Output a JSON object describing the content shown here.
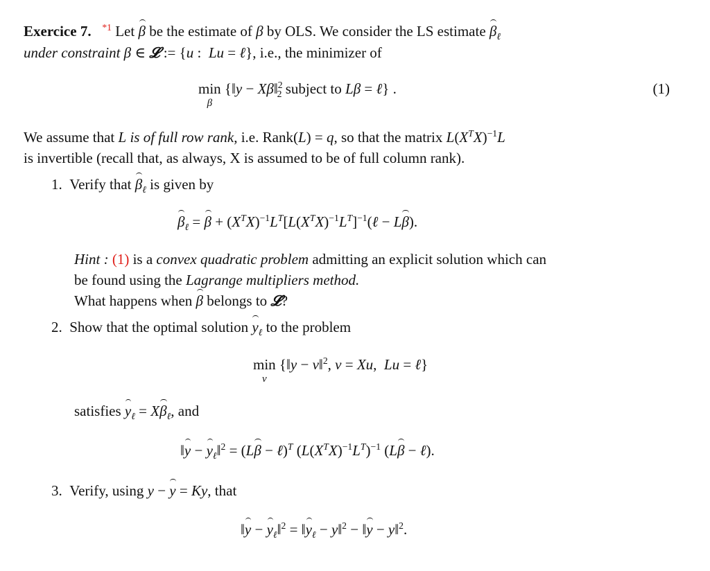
{
  "exercise": {
    "title": "Exercice 7.",
    "footnote_mark": "* 1",
    "intro_line1": "Let β̂ be the estimate of β by OLS. We consider the LS estimate β̂ℓ",
    "intro_line2": "under constraint β ∈ 𝓛 := {u : Lu = ℓ}, i.e., the minimizer of",
    "eq1": "min_β {‖y − Xβ‖₂² subject to Lβ = ℓ} .",
    "eq1_label": "(1)",
    "assume_line1": "We assume that L is of full row rank, i.e. Rank(L) = q, so that the matrix L(XᵀX)⁻¹L",
    "assume_line2": "is invertible (recall that, as always, X is assumed to be of full column rank).",
    "items": [
      {
        "num": "1.",
        "text": "Verify that β̂ℓ is given by",
        "equation": "β̂ℓ = β̂ + (XᵀX)⁻¹Lᵀ[L(XᵀX)⁻¹Lᵀ]⁻¹(ℓ − Lβ̂).",
        "hint_label": "Hint :",
        "hint_ref": "(1)",
        "hint_line1": "is a convex quadratic problem admitting an explicit solution which can",
        "hint_line2": "be found using the Lagrange multipliers method.",
        "hint_line3": "What happens when β̂ belongs to 𝓛?"
      },
      {
        "num": "2.",
        "text": "Show that the optimal solution ŷℓ to the problem",
        "equation": "min_v {‖y − v‖², v = Xu, Lu = ℓ}",
        "satisfies": "satisfies ŷℓ = Xβ̂ℓ, and",
        "equation2": "‖ŷ − ŷℓ‖² = (Lβ̂ − ℓ)ᵀ (L(XᵀX)⁻¹Lᵀ)⁻¹ (Lβ̂ − ℓ)."
      },
      {
        "num": "3.",
        "text": "Verify, using y − ŷ = Ky, that",
        "equation": "‖ŷ − ŷℓ‖² = ‖ŷℓ − y‖² − ‖ŷ − y‖²."
      }
    ],
    "colors": {
      "text": "#111111",
      "reference": "#e0201b",
      "background": "#ffffff"
    }
  }
}
